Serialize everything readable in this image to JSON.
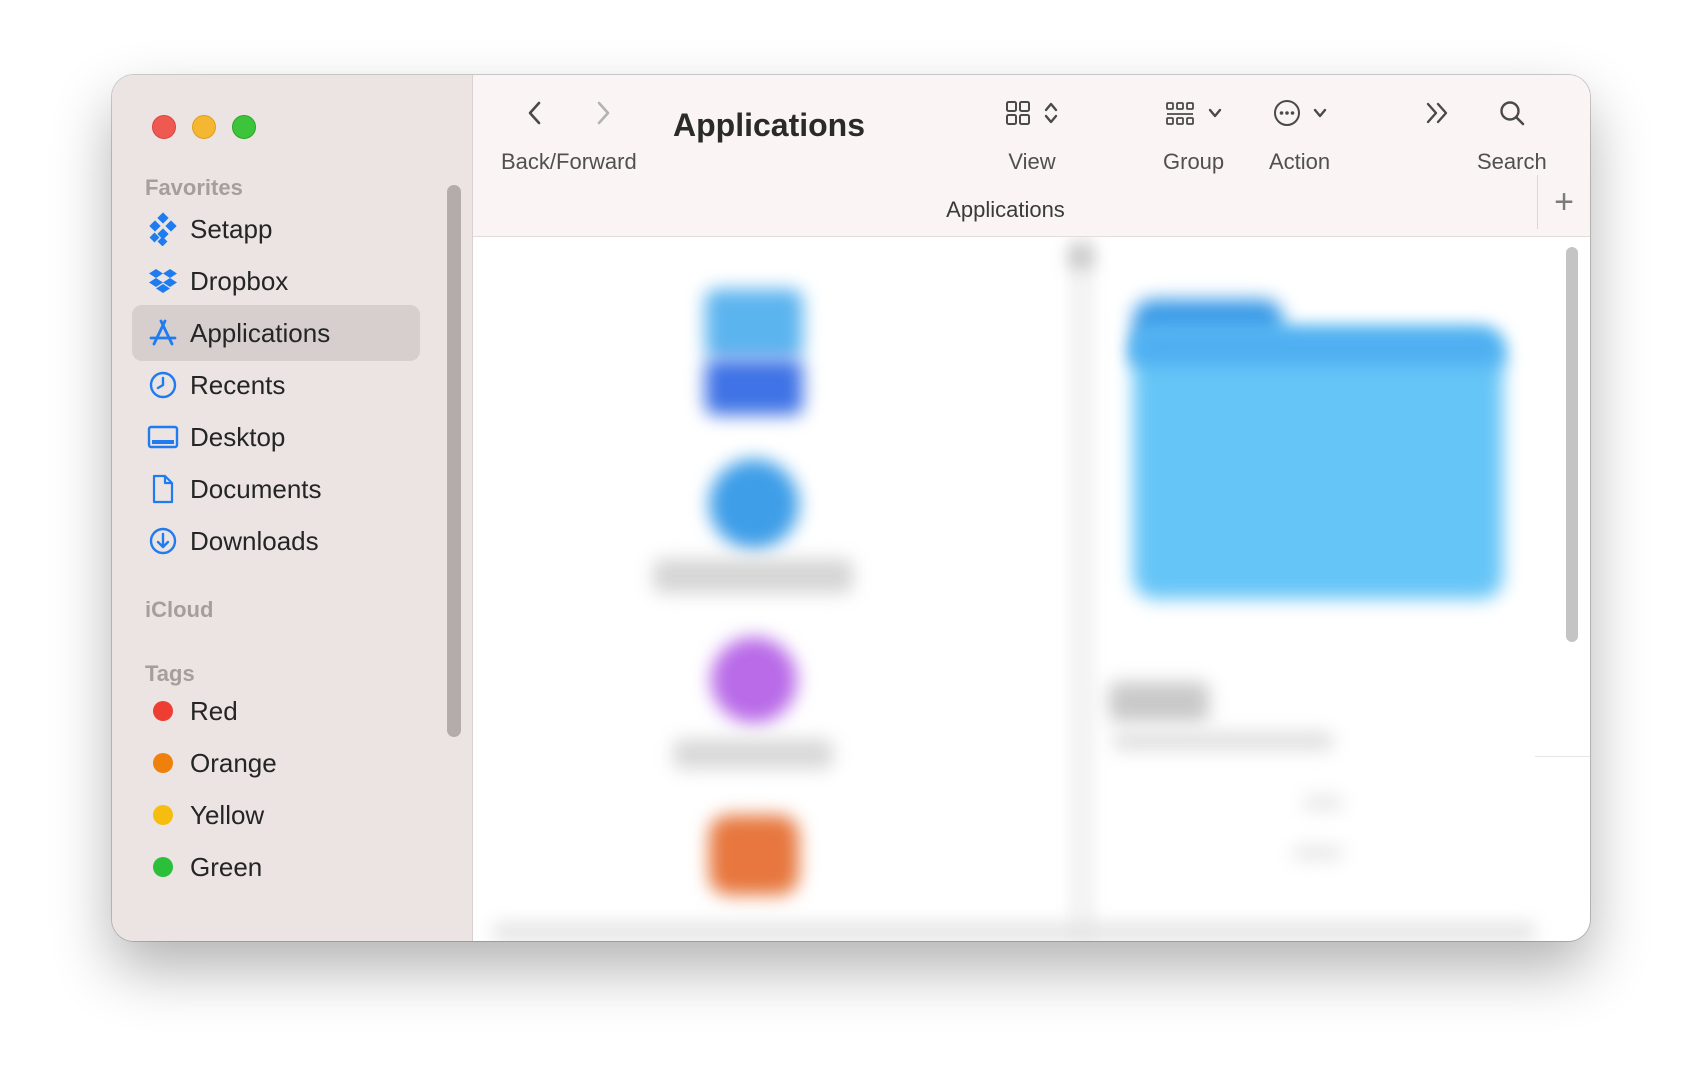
{
  "window": {
    "title": "Applications",
    "path": "Applications"
  },
  "toolbar": {
    "back_forward_label": "Back/Forward",
    "view_label": "View",
    "group_label": "Group",
    "action_label": "Action",
    "search_label": "Search",
    "new_tab_symbol": "+"
  },
  "sidebar": {
    "favorites_title": "Favorites",
    "favorites": [
      {
        "label": "Setapp",
        "icon": "setapp-icon"
      },
      {
        "label": "Dropbox",
        "icon": "dropbox-icon"
      },
      {
        "label": "Applications",
        "icon": "applications-icon",
        "selected": true
      },
      {
        "label": "Recents",
        "icon": "clock-icon"
      },
      {
        "label": "Desktop",
        "icon": "desktop-icon"
      },
      {
        "label": "Documents",
        "icon": "document-icon"
      },
      {
        "label": "Downloads",
        "icon": "download-icon"
      }
    ],
    "icloud_title": "iCloud",
    "tags_title": "Tags",
    "tags": [
      {
        "label": "Red",
        "color": "#ee3d33"
      },
      {
        "label": "Orange",
        "color": "#f0800c"
      },
      {
        "label": "Yellow",
        "color": "#f6bd10"
      },
      {
        "label": "Green",
        "color": "#2cbf3c"
      }
    ]
  },
  "colors": {
    "accent": "#1f7cf0",
    "sidebar_bg": "#ebe4e3",
    "selected_bg": "#d6cfce"
  }
}
